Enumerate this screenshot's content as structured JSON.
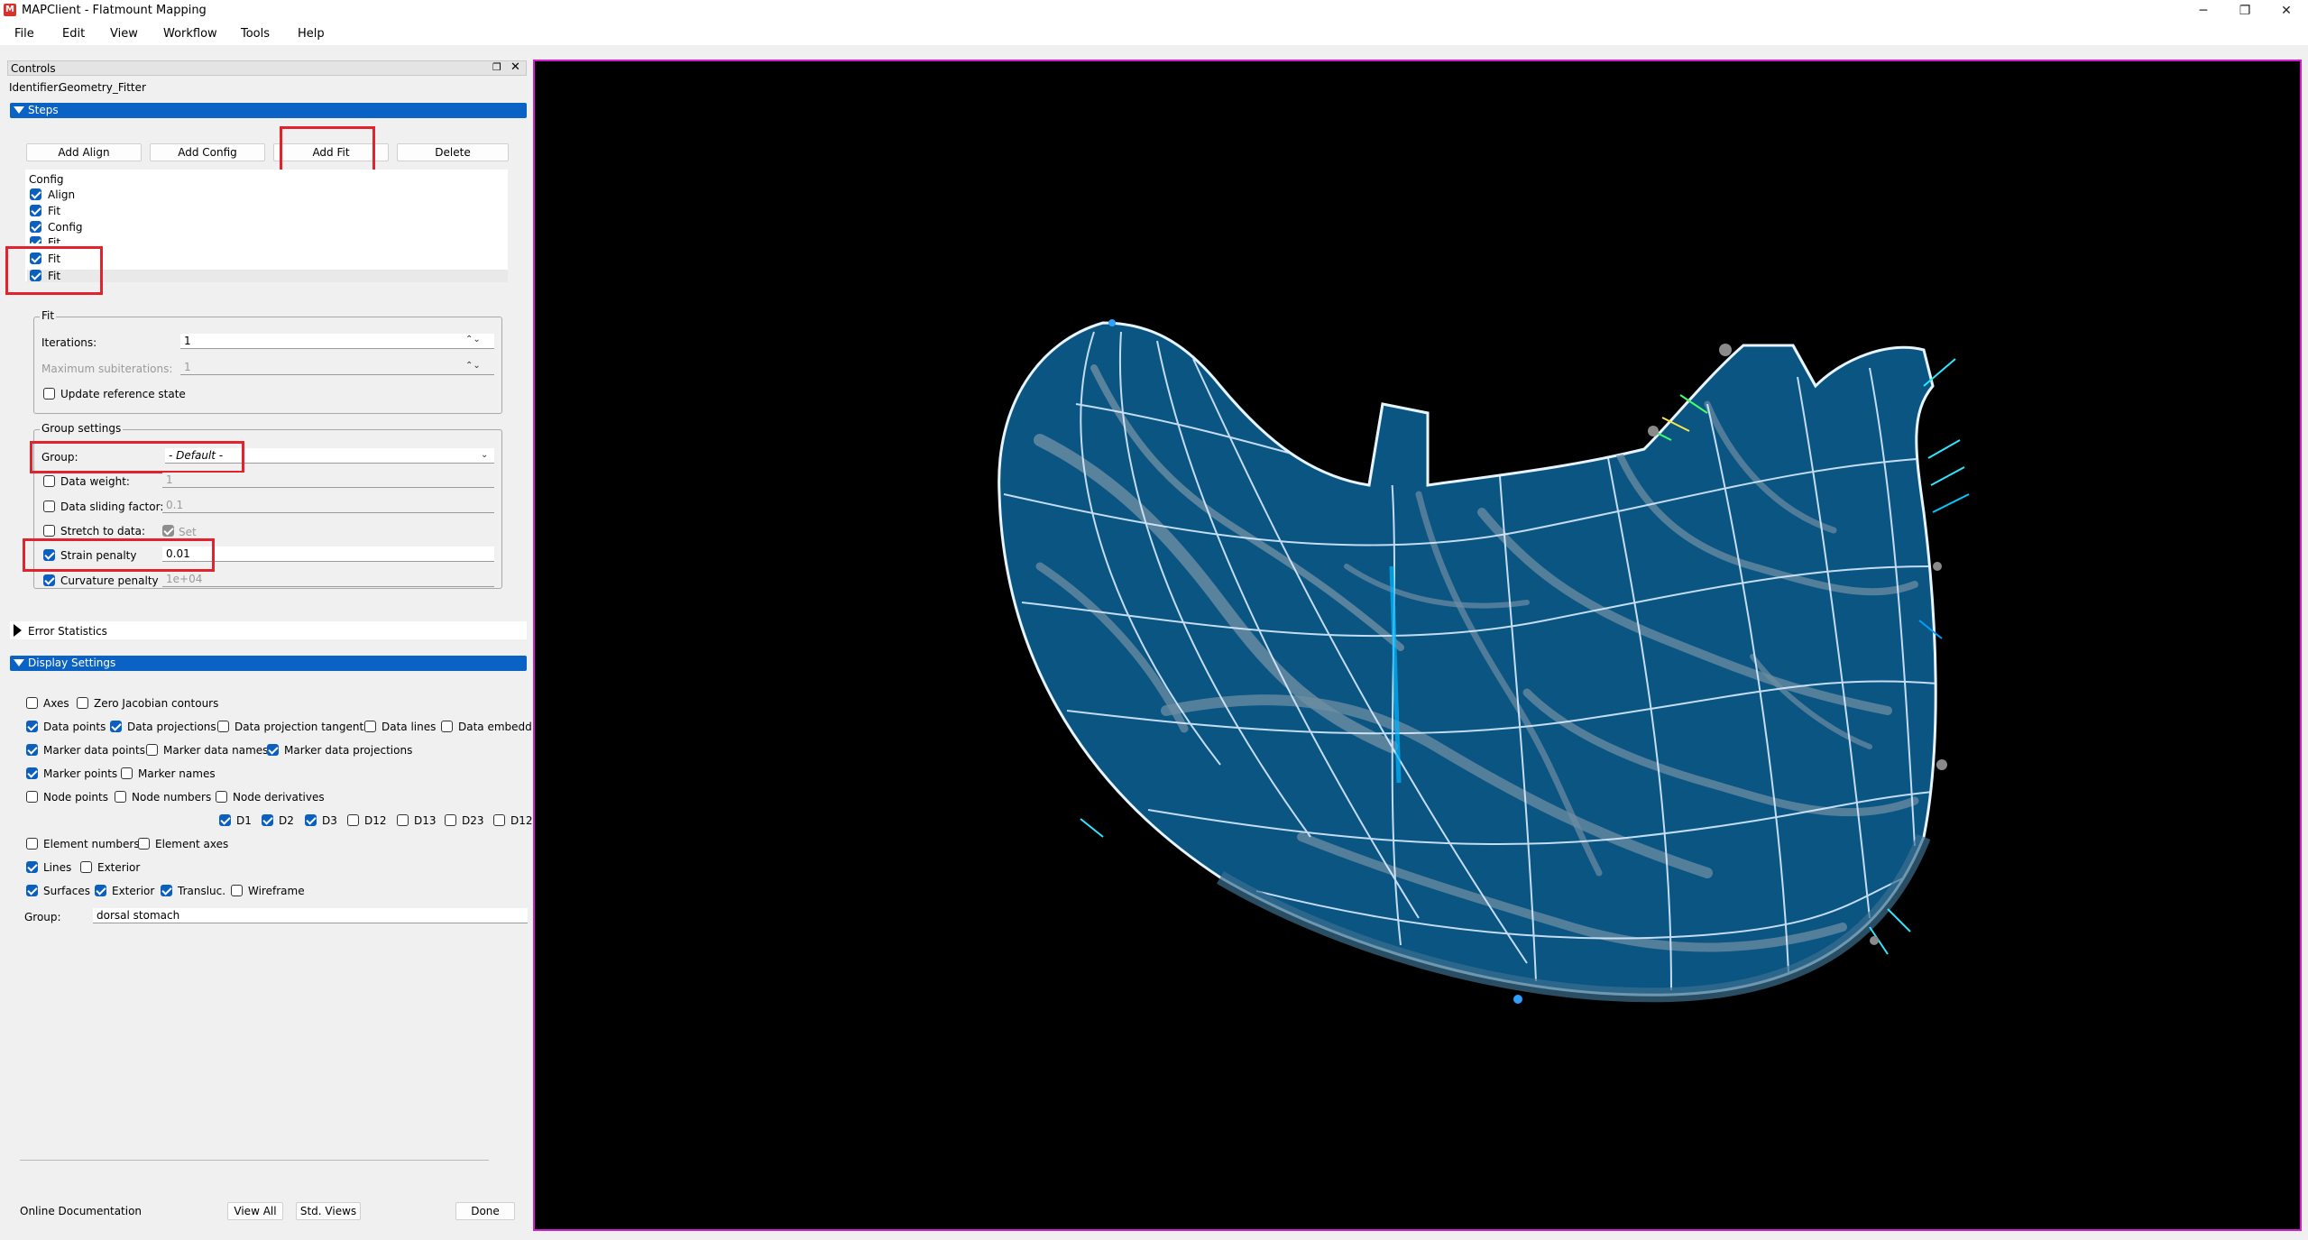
{
  "window": {
    "title": "MAPClient - Flatmount Mapping",
    "buttons": {
      "minimize": "─",
      "restore": "❐",
      "close": "✕"
    }
  },
  "menu": {
    "items": [
      "File",
      "Edit",
      "View",
      "Workflow",
      "Tools",
      "Help"
    ]
  },
  "controls": {
    "title": "Controls",
    "identifier_label": "Identifier:",
    "identifier_value": "Geometry_Fitter",
    "steps_label": "Steps",
    "buttons": {
      "add_align": "Add Align",
      "add_config": "Add Config",
      "add_fit": "Add Fit",
      "delete": "Delete"
    },
    "step_list": [
      {
        "label": "Config",
        "checked": null
      },
      {
        "label": "Align",
        "checked": true
      },
      {
        "label": "Fit",
        "checked": true
      },
      {
        "label": "Config",
        "checked": true
      },
      {
        "label": "Fit",
        "checked": true
      },
      {
        "label": "Fit",
        "checked": true
      },
      {
        "label": "Fit",
        "checked": true
      }
    ],
    "fit": {
      "title": "Fit",
      "iterations_label": "Iterations:",
      "iterations_value": "1",
      "max_subiterations_label": "Maximum subiterations:",
      "max_subiterations_value": "1",
      "update_reference_label": "Update reference state"
    },
    "group_settings": {
      "title": "Group settings",
      "group_label": "Group:",
      "group_value": "- Default -",
      "data_weight_label": "Data weight:",
      "data_weight_value": "1",
      "data_sliding_label": "Data sliding factor:",
      "data_sliding_value": "0.1",
      "stretch_label": "Stretch to data:",
      "stretch_set": "Set",
      "strain_label": "Strain penalty",
      "strain_value": "0.01",
      "curvature_label": "Curvature penalty",
      "curvature_value": "1e+04"
    },
    "error_statistics_label": "Error Statistics",
    "display_settings_label": "Display Settings",
    "display": {
      "row1": [
        {
          "label": "Axes",
          "checked": false
        },
        {
          "label": "Zero Jacobian contours",
          "checked": false
        }
      ],
      "row2": [
        {
          "label": "Data points",
          "checked": true
        },
        {
          "label": "Data projections",
          "checked": true
        },
        {
          "label": "Data projection tangents",
          "checked": false
        },
        {
          "label": "Data lines",
          "checked": false
        },
        {
          "label": "Data embedde",
          "checked": false
        }
      ],
      "row3": [
        {
          "label": "Marker data points",
          "checked": true
        },
        {
          "label": "Marker data names",
          "checked": false
        },
        {
          "label": "Marker data projections",
          "checked": true
        }
      ],
      "row4": [
        {
          "label": "Marker points",
          "checked": true
        },
        {
          "label": "Marker names",
          "checked": false
        }
      ],
      "row5": [
        {
          "label": "Node points",
          "checked": false
        },
        {
          "label": "Node numbers",
          "checked": false
        },
        {
          "label": "Node derivatives",
          "checked": false
        }
      ],
      "row6": [
        {
          "label": "D1",
          "checked": true
        },
        {
          "label": "D2",
          "checked": true
        },
        {
          "label": "D3",
          "checked": true
        },
        {
          "label": "D12",
          "checked": false
        },
        {
          "label": "D13",
          "checked": false
        },
        {
          "label": "D23",
          "checked": false
        },
        {
          "label": "D12",
          "checked": false
        }
      ],
      "row7": [
        {
          "label": "Element numbers",
          "checked": false
        },
        {
          "label": "Element axes",
          "checked": false
        }
      ],
      "row8": [
        {
          "label": "Lines",
          "checked": true
        },
        {
          "label": "Exterior",
          "checked": false
        }
      ],
      "row9": [
        {
          "label": "Surfaces",
          "checked": true
        },
        {
          "label": "Exterior",
          "checked": true
        },
        {
          "label": "Transluc.",
          "checked": true
        },
        {
          "label": "Wireframe",
          "checked": false
        }
      ],
      "group_label": "Group:",
      "group_value": "dorsal stomach"
    },
    "footer": {
      "online_docs": "Online Documentation",
      "view_all": "View All",
      "std_views": "Std. Views",
      "done": "Done"
    }
  },
  "viewport": {
    "background": "#000000",
    "border_color": "#d11dcf",
    "mesh_fill": "#0b5583",
    "mesh_lines": "#d8ecff",
    "data_color": "#6d8da2"
  }
}
